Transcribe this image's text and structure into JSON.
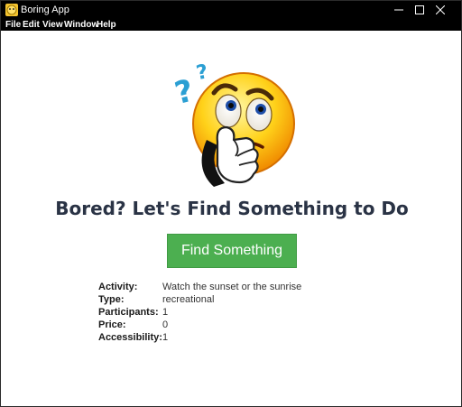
{
  "window": {
    "title": "Boring App",
    "controls": {
      "minimize": "minimize",
      "maximize": "maximize",
      "close": "close"
    }
  },
  "menu": [
    "File",
    "Edit",
    "View",
    "Window",
    "Help"
  ],
  "main": {
    "headline": "Bored? Let's Find Something to Do",
    "find_button": "Find Something",
    "details": [
      {
        "label": "Activity:",
        "value": "Watch the sunset or the sunrise"
      },
      {
        "label": "Type:",
        "value": "recreational"
      },
      {
        "label": "Participants:",
        "value": "1"
      },
      {
        "label": "Price:",
        "value": "0"
      },
      {
        "label": "Accessibility:",
        "value": "1"
      }
    ]
  },
  "icons": {
    "app": "boring-app-icon",
    "illustration": "thinking-emoji-icon"
  },
  "colors": {
    "titlebar": "#000000",
    "button": "#4caf50",
    "headline": "#2a3345"
  }
}
